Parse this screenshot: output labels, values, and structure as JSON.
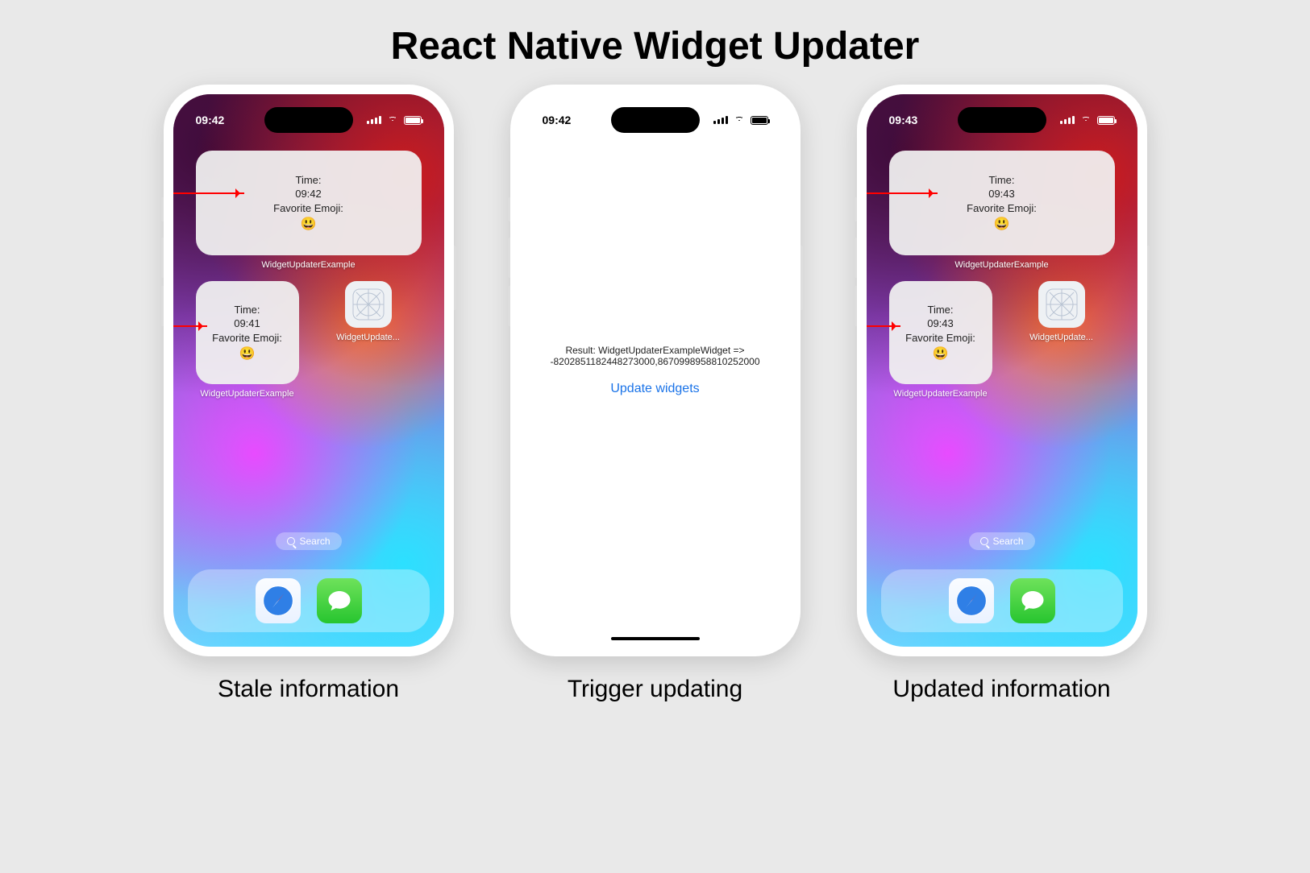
{
  "title": "React Native Widget Updater",
  "captions": {
    "left": "Stale information",
    "middle": "Trigger updating",
    "right": "Updated information"
  },
  "widget_text": {
    "time_label": "Time:",
    "fav_label": "Favorite Emoji:",
    "emoji": "😃"
  },
  "staleHome": {
    "status_time": "09:42",
    "medium_time": "09:42",
    "small_time": "09:41",
    "widget_caption": "WidgetUpdaterExample",
    "small_widget_caption": "WidgetUpdaterExample",
    "app_icon_caption": "WidgetUpdate...",
    "search": "Search"
  },
  "updatedHome": {
    "status_time": "09:43",
    "medium_time": "09:43",
    "small_time": "09:43",
    "widget_caption": "WidgetUpdaterExample",
    "small_widget_caption": "WidgetUpdaterExample",
    "app_icon_caption": "WidgetUpdate...",
    "search": "Search"
  },
  "appScreen": {
    "status_time": "09:42",
    "result_line1": "Result: WidgetUpdaterExampleWidget =>",
    "result_line2": "-8202851182448273000,8670998958810252000",
    "button": "Update widgets"
  }
}
